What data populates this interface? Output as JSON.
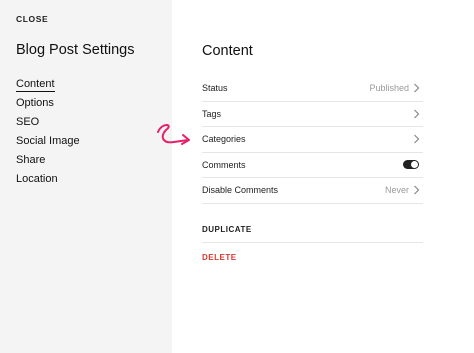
{
  "sidebar": {
    "close_label": "CLOSE",
    "title": "Blog Post Settings",
    "items": [
      {
        "label": "Content"
      },
      {
        "label": "Options"
      },
      {
        "label": "SEO"
      },
      {
        "label": "Social Image"
      },
      {
        "label": "Share"
      },
      {
        "label": "Location"
      }
    ]
  },
  "main": {
    "title": "Content",
    "rows": [
      {
        "label": "Status",
        "value": "Published"
      },
      {
        "label": "Tags",
        "value": ""
      },
      {
        "label": "Categories",
        "value": ""
      },
      {
        "label": "Comments",
        "toggle": "on"
      },
      {
        "label": "Disable Comments",
        "value": "Never"
      }
    ],
    "duplicate_label": "DUPLICATE",
    "delete_label": "DELETE"
  },
  "colors": {
    "sidebar_bg": "#f4f4f4",
    "delete": "#d8362e",
    "annotation": "#e5206a"
  },
  "icons": [
    "chevron-right-icon",
    "toggle-on-icon",
    "annotation-arrow-icon"
  ]
}
